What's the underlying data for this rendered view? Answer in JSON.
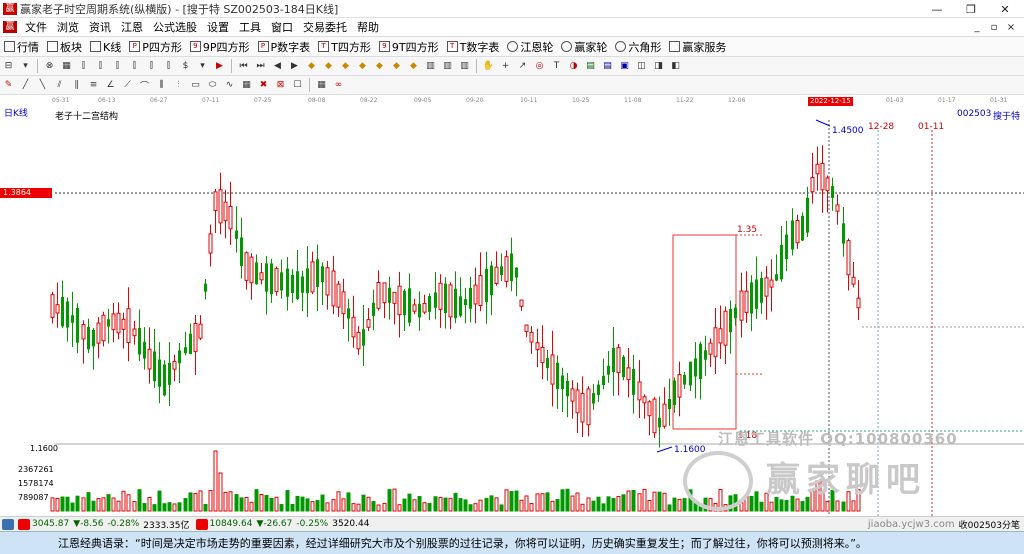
{
  "window": {
    "title": "赢家老子时空周期系统(纵横版) - [搜于特  SZ002503-184日K线]",
    "controls": [
      "—",
      "❐",
      "✕"
    ],
    "mdi_controls": [
      "_",
      "▫",
      "×"
    ]
  },
  "menu": [
    "文件",
    "浏览",
    "资讯",
    "江恩",
    "公式选股",
    "设置",
    "工具",
    "窗口",
    "交易委托",
    "帮助"
  ],
  "toolbar1": [
    "行情",
    "板块",
    "K线",
    "P四方形",
    "9P四方形",
    "P数字表",
    "T四方形",
    "9T四方形",
    "T数字表",
    "江恩轮",
    "赢家轮",
    "六角形",
    "赢家服务"
  ],
  "dates": [
    "05-31",
    "06-13",
    "06-27",
    "07-11",
    "07-25",
    "08-08",
    "08-22",
    "09-05",
    "09-20",
    "10-11",
    "10-25",
    "11-08",
    "11-22",
    "12-06",
    "2022-12-15",
    "01-03",
    "01-17",
    "01-31"
  ],
  "chart": {
    "period": "日K线",
    "structure": "老子十二宫结构",
    "code": "002503",
    "name": "搜于特",
    "current_price": "1.3864",
    "low_price": "1.1600",
    "high_label": "1.4500",
    "low_label": "1.1600",
    "box_high": "1.35",
    "box_low": "1.18",
    "date_a": "12-28",
    "date_b": "01-11",
    "volume_ticks": [
      "2367261",
      "1578174",
      "789087"
    ],
    "colors": {
      "up": "#e60000",
      "down": "#009900",
      "select": "#ff0000"
    }
  },
  "watermark": {
    "line1": "江恩工具软件 QQ:100800360",
    "line2": "赢家聊吧",
    "url": "jiaoba.ycjw3.com"
  },
  "status": {
    "sh_index": "3045.87",
    "sh_change": "▼-8.56",
    "sh_pct": "-0.28%",
    "sh_amount": "2333.35亿",
    "sz_index": "10849.64",
    "sz_change": "▼-26.67",
    "sz_pct": "-0.25%",
    "sz_amount": "3520.44",
    "receive": "收002503分笔"
  },
  "quote": "江恩经典语录：“时间是决定市场走势的重要因素，经过详细研究大市及个别股票的过往记录，你将可以证明，历史确实重复发生；而了解过往，你将可以预测将来。”。"
}
